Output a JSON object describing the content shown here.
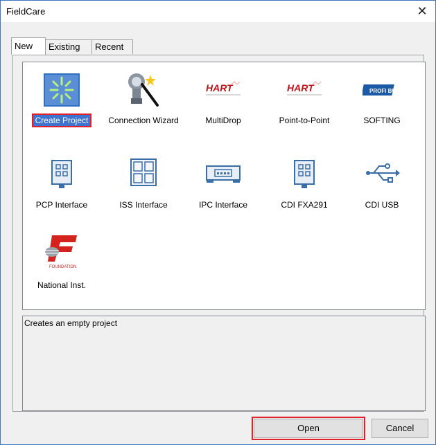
{
  "window": {
    "title": "FieldCare"
  },
  "tabs": [
    {
      "label": "New",
      "active": true
    },
    {
      "label": "Existing",
      "active": false
    },
    {
      "label": "Recent",
      "active": false
    }
  ],
  "items": [
    {
      "label": "Create Project",
      "icon": "create-project-icon",
      "selected": true
    },
    {
      "label": "Connection Wizard",
      "icon": "connection-wizard-icon"
    },
    {
      "label": "MultiDrop",
      "icon": "hart-icon",
      "brand": "HART"
    },
    {
      "label": "Point-to-Point",
      "icon": "hart-icon",
      "brand": "HART"
    },
    {
      "label": "SOFTING",
      "icon": "profibus-icon",
      "brand": "PROFI BUS"
    },
    {
      "label": "PCP Interface",
      "icon": "interface-module-icon"
    },
    {
      "label": "ISS Interface",
      "icon": "interface-grid-icon"
    },
    {
      "label": "IPC Interface",
      "icon": "ipc-card-icon"
    },
    {
      "label": "CDI FXA291",
      "icon": "interface-module-icon"
    },
    {
      "label": "CDI USB",
      "icon": "usb-icon"
    },
    {
      "label": "National Inst.",
      "icon": "foundation-fieldbus-icon",
      "brand": "FOUNDATION"
    }
  ],
  "description": "Creates an empty project",
  "buttons": {
    "open": "Open",
    "cancel": "Cancel"
  },
  "colors": {
    "selection": "#3e73d0",
    "highlight": "#e0212a",
    "hart": "#c0141b",
    "profibus": "#1d5aa6"
  }
}
